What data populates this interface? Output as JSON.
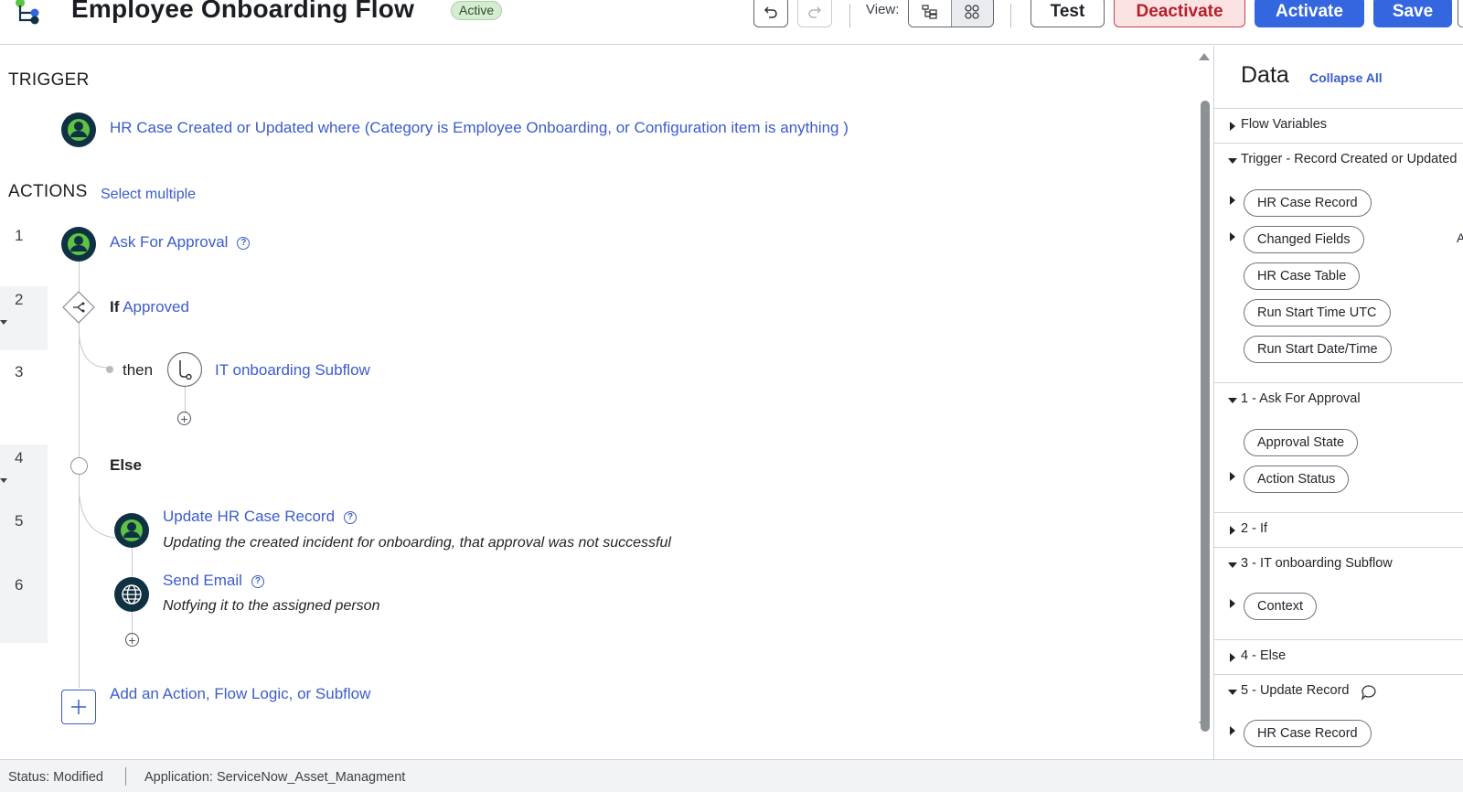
{
  "header": {
    "title": "Employee Onboarding Flow",
    "status": "Active",
    "view_label": "View:",
    "buttons": {
      "test": "Test",
      "deactivate": "Deactivate",
      "activate": "Activate",
      "save": "Save"
    },
    "icons": {
      "undo": "undo-icon",
      "redo": "redo-icon",
      "tree_view": "tree-view-icon",
      "diagram_view": "diagram-view-icon"
    }
  },
  "trigger": {
    "heading": "TRIGGER",
    "text": "HR Case Created or Updated where (Category is Employee Onboarding, or Configuration item is anything )"
  },
  "actions": {
    "heading": "ACTIONS",
    "select_multiple": "Select multiple",
    "steps": [
      {
        "num": "1",
        "label": "Ask For Approval"
      },
      {
        "num": "2",
        "keyword": "If",
        "label": "Approved"
      },
      {
        "num": "3",
        "prefix": "then",
        "label": "IT onboarding Subflow"
      },
      {
        "num": "4",
        "label": "Else"
      },
      {
        "num": "5",
        "label": "Update HR Case Record",
        "description": "Updating the created incident for onboarding, that approval was not successful"
      },
      {
        "num": "6",
        "label": "Send Email",
        "description": "Notfying it to the assigned person"
      }
    ],
    "add_label": "Add an Action, Flow Logic, or Subflow"
  },
  "data_panel": {
    "title": "Data",
    "collapse_all": "Collapse All",
    "flow_variables": "Flow Variables",
    "trigger_section": "Trigger - Record Created or Updated",
    "trigger_pills": [
      "HR Case Record",
      "Changed Fields",
      "HR Case Table",
      "Run Start Time UTC",
      "Run Start Date/Time"
    ],
    "edge_letter": "A",
    "step1": "1 - Ask For Approval",
    "step1_pills": [
      "Approval State",
      "Action Status"
    ],
    "step2": "2 - If",
    "step3": "3 - IT onboarding Subflow",
    "step3_pills": [
      "Context"
    ],
    "step4": "4 - Else",
    "step5": "5 - Update Record",
    "step5_pills": [
      "HR Case Record"
    ]
  },
  "footer": {
    "status": "Status: Modified",
    "application": "Application: ServiceNow_Asset_Managment"
  },
  "colors": {
    "accent": "#3467df",
    "link": "#3b5ccc",
    "deactivate": "#b3202b",
    "active_green": "#5cc343",
    "node_dark": "#0f3142"
  }
}
